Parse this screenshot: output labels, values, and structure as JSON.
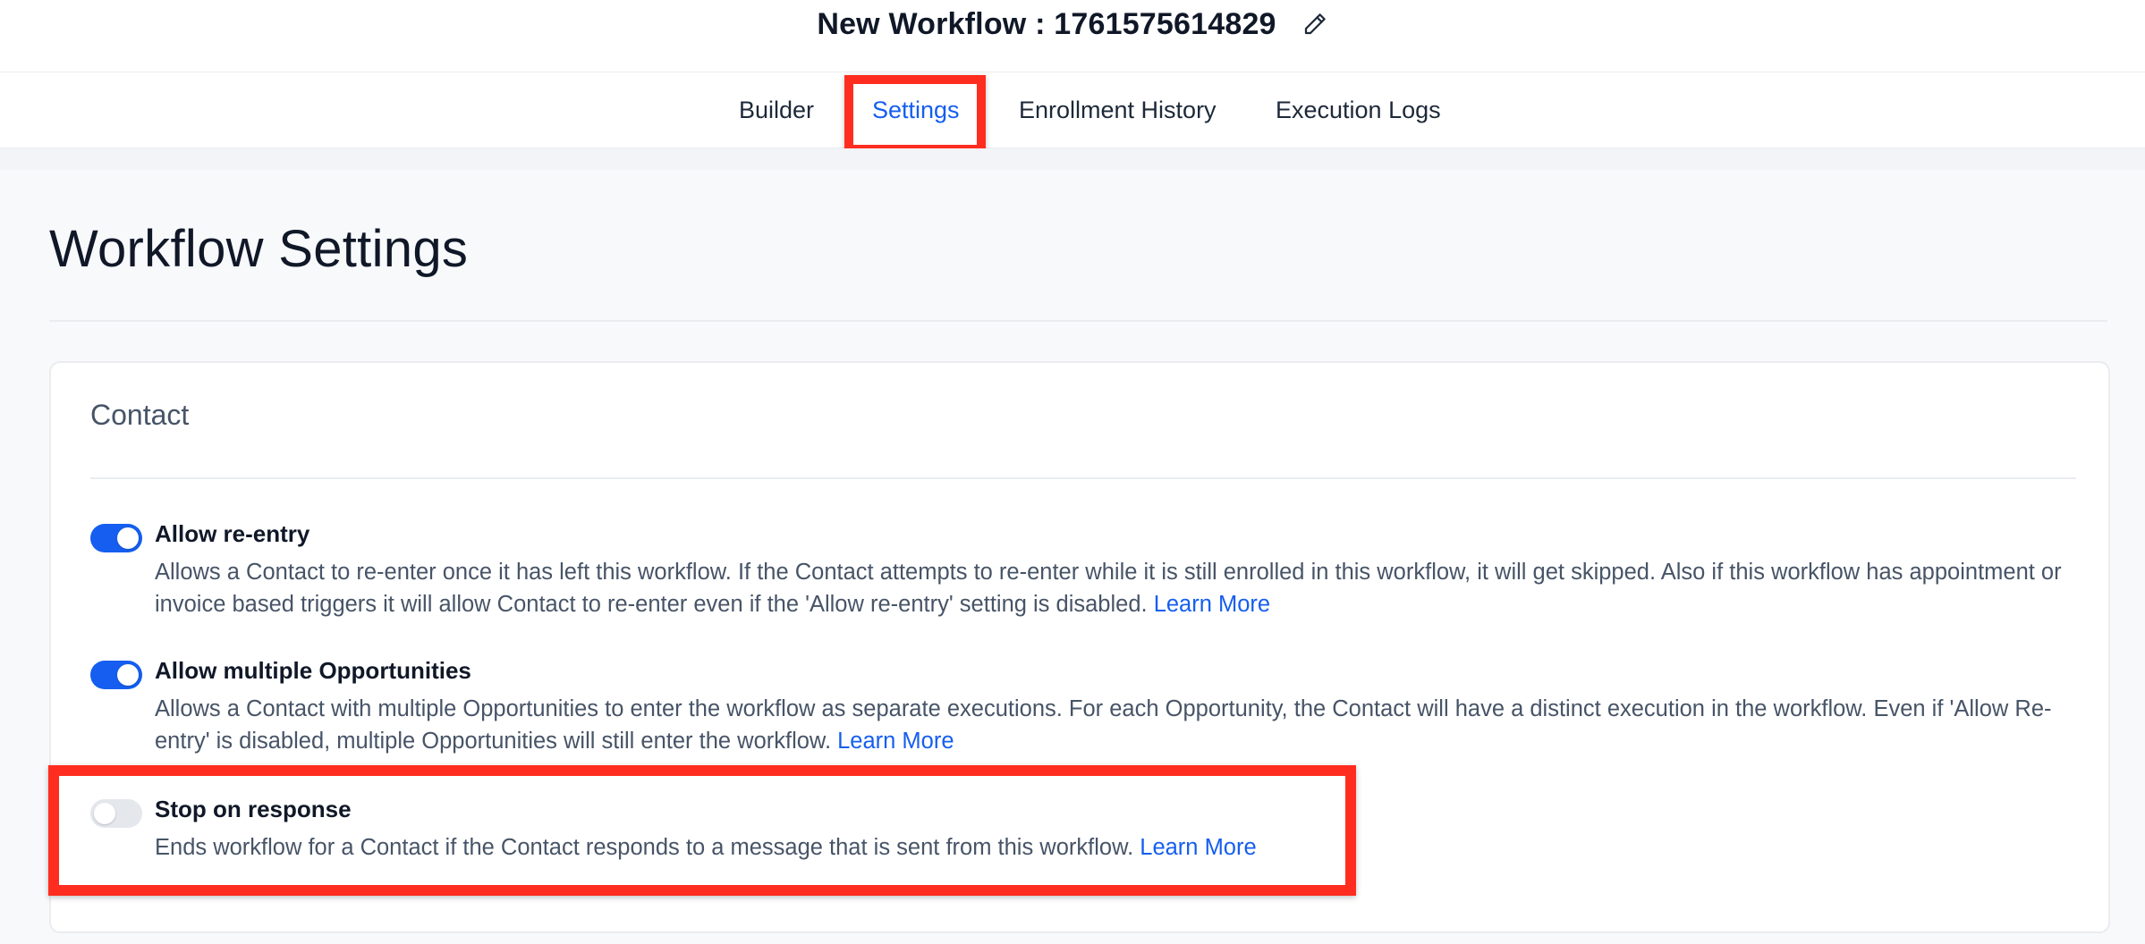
{
  "header": {
    "workflow_title": "New Workflow : 1761575614829",
    "edit_icon": "pencil-icon"
  },
  "tabs": [
    {
      "label": "Builder",
      "active": false
    },
    {
      "label": "Settings",
      "active": true
    },
    {
      "label": "Enrollment History",
      "active": false
    },
    {
      "label": "Execution Logs",
      "active": false
    }
  ],
  "page": {
    "title": "Workflow Settings"
  },
  "contact_card": {
    "title": "Contact",
    "settings": [
      {
        "label": "Allow re-entry",
        "enabled": true,
        "description": "Allows a Contact to re-enter once it has left this workflow. If the Contact attempts to re-enter while it is still enrolled in this workflow, it will get skipped. Also if this workflow has appointment or invoice based triggers it will allow Contact to re-enter even if the 'Allow re-entry' setting is disabled.",
        "link": "Learn More"
      },
      {
        "label": "Allow multiple Opportunities",
        "enabled": true,
        "description": "Allows a Contact with multiple Opportunities to enter the workflow as separate executions. For each Opportunity, the Contact will have a distinct execution in the workflow. Even if 'Allow Re-entry' is disabled, multiple Opportunities will still enter the workflow.",
        "link": "Learn More"
      },
      {
        "label": "Stop on response",
        "enabled": false,
        "description": "Ends workflow for a Contact if the Contact responds to a message that is sent from this workflow.",
        "link": "Learn More"
      }
    ]
  },
  "colors": {
    "accent": "#155eef",
    "highlight": "#ff2d20",
    "toggle_off": "#e4e7ec"
  }
}
